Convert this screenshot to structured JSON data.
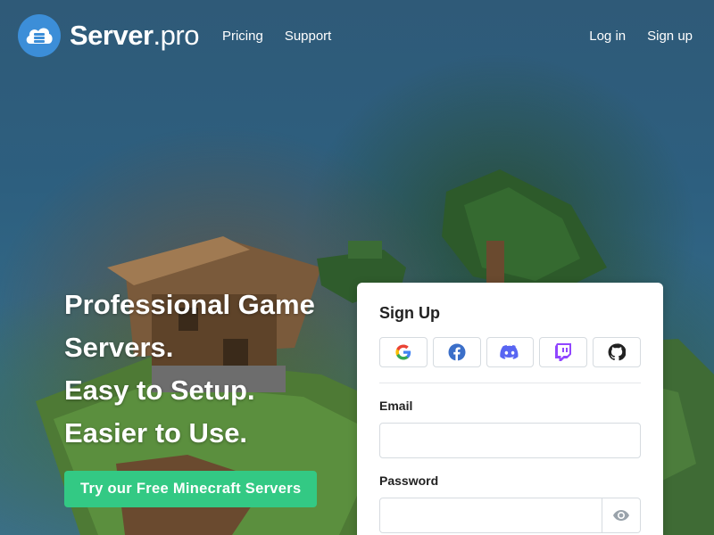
{
  "header": {
    "logo": {
      "brand": "Server",
      "suffix": ".pro",
      "icon": "cloud-server-icon"
    },
    "nav": [
      {
        "label": "Pricing"
      },
      {
        "label": "Support"
      }
    ],
    "auth": {
      "login": "Log in",
      "signup": "Sign up"
    }
  },
  "hero": {
    "lines": [
      "Professional Game",
      "Servers.",
      "Easy to Setup.",
      "Easier to Use."
    ],
    "cta": "Try our Free Minecraft Servers"
  },
  "signup_form": {
    "title": "Sign Up",
    "social_buttons": [
      {
        "icon": "google-icon"
      },
      {
        "icon": "facebook-icon"
      },
      {
        "icon": "discord-icon"
      },
      {
        "icon": "twitch-icon"
      },
      {
        "icon": "github-icon"
      }
    ],
    "email": {
      "label": "Email",
      "value": ""
    },
    "password": {
      "label": "Password",
      "value": "",
      "toggle_icon": "eye-icon"
    }
  },
  "colors": {
    "cta": "#33c984",
    "logo_blue": "#3c8ed8",
    "background": "#2f5a78"
  }
}
